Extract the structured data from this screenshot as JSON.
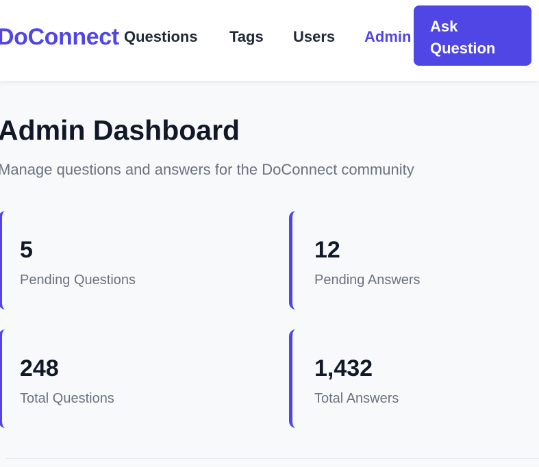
{
  "nav": {
    "brand": "DoConnect",
    "links": [
      "Questions",
      "Tags",
      "Users",
      "Admin"
    ],
    "active_link": "Admin",
    "ask_button": {
      "line1": "Ask",
      "line2": "Question"
    }
  },
  "header": {
    "title": "Admin Dashboard",
    "subtitle": "Manage questions and answers for the DoConnect community"
  },
  "stats": [
    {
      "value": "5",
      "label": "Pending Questions"
    },
    {
      "value": "12",
      "label": "Pending Answers"
    },
    {
      "value": "248",
      "label": "Total Questions"
    },
    {
      "value": "1,432",
      "label": "Total Answers"
    }
  ],
  "colors": {
    "accent": "#4f46e5",
    "text_dark": "#111827",
    "text_muted": "#6b7280",
    "page_bg": "#f8f9fb"
  }
}
